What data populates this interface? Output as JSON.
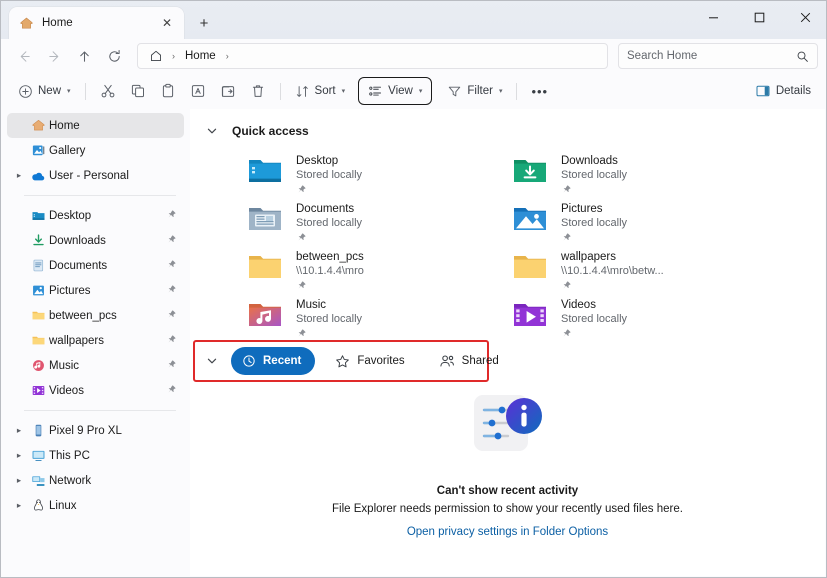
{
  "window": {
    "tab_title": "Home",
    "tab_icon": "home-icon",
    "close_tab_label": "✕",
    "new_tab_label": "+",
    "minimize_label": "─",
    "maximize_label": "□",
    "close_label": "✕"
  },
  "nav": {
    "back": "back-arrow",
    "forward": "forward-arrow",
    "up": "up-arrow",
    "refresh": "refresh-arrow",
    "breadcrumb_home_icon": "home-outline-icon",
    "breadcrumb_sep": "›",
    "breadcrumb_label": "Home",
    "breadcrumb_sep2": "›"
  },
  "search": {
    "placeholder": "Search Home",
    "icon": "search-icon"
  },
  "commandbar": {
    "new_label": "New",
    "new_caret": "▾",
    "cut_label": "cut-icon",
    "copy_label": "copy-icon",
    "paste_label": "paste-icon",
    "rename_label": "rename-icon",
    "share_label": "share-icon",
    "delete_label": "delete-icon",
    "sort_label": "Sort",
    "sort_caret": "▾",
    "view_label": "View",
    "view_caret": "▾",
    "filter_label": "Filter",
    "filter_caret": "▾",
    "more_label": "•••",
    "details_label": "Details"
  },
  "sidebar": {
    "items": [
      {
        "label": "Home",
        "icon": "home-icon",
        "selected": true,
        "expandable": false,
        "pinned": false
      },
      {
        "label": "Gallery",
        "icon": "gallery-icon",
        "selected": false,
        "expandable": false,
        "pinned": false
      },
      {
        "label": "User - Personal",
        "icon": "onedrive-icon",
        "selected": false,
        "expandable": true,
        "pinned": false
      }
    ],
    "pinned_items": [
      {
        "label": "Desktop",
        "icon": "desktop-folder-icon",
        "pinned": true
      },
      {
        "label": "Downloads",
        "icon": "downloads-folder-icon",
        "pinned": true
      },
      {
        "label": "Documents",
        "icon": "documents-folder-icon",
        "pinned": true
      },
      {
        "label": "Pictures",
        "icon": "pictures-folder-icon",
        "pinned": true
      },
      {
        "label": "between_pcs",
        "icon": "folder-icon",
        "pinned": true
      },
      {
        "label": "wallpapers",
        "icon": "folder-icon",
        "pinned": true
      },
      {
        "label": "Music",
        "icon": "music-folder-icon",
        "pinned": true
      },
      {
        "label": "Videos",
        "icon": "videos-folder-icon",
        "pinned": true
      }
    ],
    "device_items": [
      {
        "label": "Pixel 9 Pro XL",
        "icon": "phone-icon",
        "expandable": true
      },
      {
        "label": "This PC",
        "icon": "pc-icon",
        "expandable": true
      },
      {
        "label": "Network",
        "icon": "network-icon",
        "expandable": true
      },
      {
        "label": "Linux",
        "icon": "linux-icon",
        "expandable": true
      }
    ]
  },
  "quick_access": {
    "chevron": "⌄",
    "title": "Quick access",
    "tiles": [
      {
        "name": "Desktop",
        "sub": "Stored locally",
        "icon": "desktop-folder-icon",
        "pinned": true
      },
      {
        "name": "Downloads",
        "sub": "Stored locally",
        "icon": "downloads-folder-icon",
        "pinned": true
      },
      {
        "name": "Documents",
        "sub": "Stored locally",
        "icon": "documents-folder-icon",
        "pinned": true
      },
      {
        "name": "Pictures",
        "sub": "Stored locally",
        "icon": "pictures-folder-icon",
        "pinned": true
      },
      {
        "name": "between_pcs",
        "sub": "\\\\10.1.4.4\\mro",
        "icon": "folder-icon",
        "pinned": true
      },
      {
        "name": "wallpapers",
        "sub": "\\\\10.1.4.4\\mro\\betw...",
        "icon": "folder-icon",
        "pinned": true
      },
      {
        "name": "Music",
        "sub": "Stored locally",
        "icon": "music-folder-icon",
        "pinned": true
      },
      {
        "name": "Videos",
        "sub": "Stored locally",
        "icon": "videos-folder-icon",
        "pinned": true
      }
    ]
  },
  "pivot": {
    "chevron": "⌄",
    "tabs": [
      {
        "label": "Recent",
        "icon": "clock-icon",
        "active": true
      },
      {
        "label": "Favorites",
        "icon": "star-icon",
        "active": false
      },
      {
        "label": "Shared",
        "icon": "people-icon",
        "active": false
      }
    ]
  },
  "empty_state": {
    "illustration": "settings-info-icon",
    "title": "Can't show recent activity",
    "description": "File Explorer needs permission to show your recently used files here.",
    "link": "Open privacy settings in Folder Options"
  },
  "colors": {
    "accent": "#0f6cbd",
    "highlight_box": "#e02a2a",
    "link": "#0b5fa4",
    "titlebar": "#e9edf3",
    "sidebar_bg": "#fbfbfd",
    "selected_row": "#e6e6e8"
  }
}
